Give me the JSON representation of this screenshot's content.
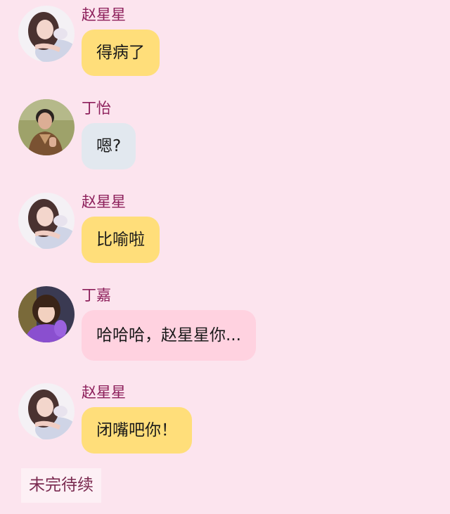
{
  "colors": {
    "background": "#fce4ee",
    "name": "#8c1e5a",
    "bubble_zhao": "#ffde7a",
    "bubble_ding_yi": "#e2e8ef",
    "bubble_ding_jia": "#ffd2e0"
  },
  "messages": [
    {
      "sender": "赵星星",
      "text": "得病了",
      "avatar": "avatar-zhao"
    },
    {
      "sender": "丁怡",
      "text": "嗯?",
      "avatar": "avatar-ding-yi"
    },
    {
      "sender": "赵星星",
      "text": "比喻啦",
      "avatar": "avatar-zhao"
    },
    {
      "sender": "丁嘉",
      "text": "哈哈哈，赵星星你...",
      "avatar": "avatar-ding-jia"
    },
    {
      "sender": "赵星星",
      "text": "闭嘴吧你！",
      "avatar": "avatar-zhao"
    }
  ],
  "footer": {
    "tag": "未完待续"
  }
}
